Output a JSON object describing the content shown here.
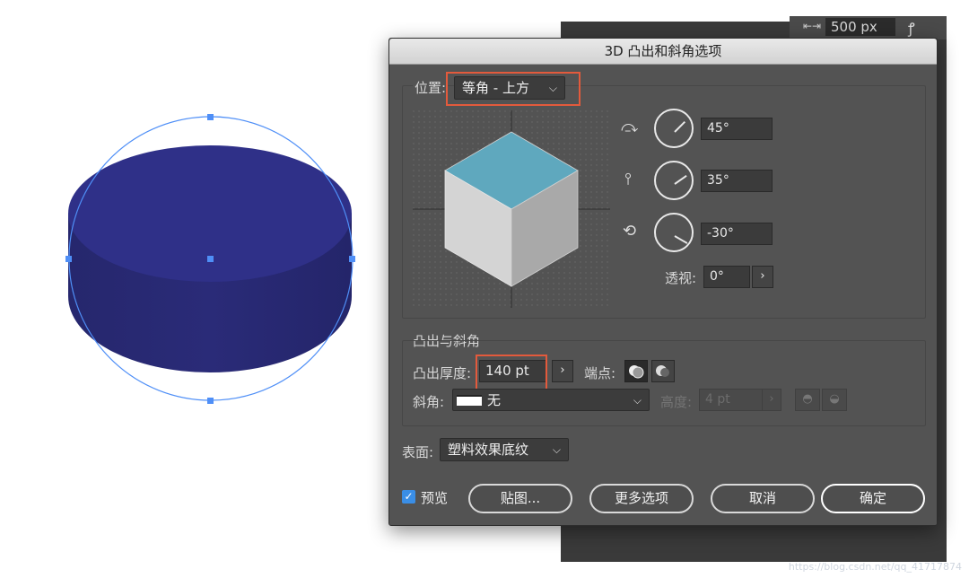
{
  "background_panel": {
    "size_value": "500 px"
  },
  "dialog": {
    "title": "3D 凸出和斜角选项",
    "position": {
      "label": "位置:",
      "selected": "等角 - 上方",
      "rotation_x": "45°",
      "rotation_y": "35°",
      "rotation_z": "-30°",
      "perspective_label": "透视:",
      "perspective_value": "0°"
    },
    "extrude": {
      "section_title": "凸出与斜角",
      "depth_label": "凸出厚度:",
      "depth_value": "140 pt",
      "cap_label": "端点:",
      "bevel_label": "斜角:",
      "bevel_value": "无",
      "height_label": "高度:",
      "height_value": "4 pt"
    },
    "surface": {
      "label": "表面:",
      "selected": "塑料效果底纹"
    },
    "footer": {
      "preview_label": "预览",
      "preview_checked": true,
      "map_button": "贴图...",
      "more_options_button": "更多选项",
      "cancel_button": "取消",
      "ok_button": "确定"
    }
  },
  "colors": {
    "cylinder": "#2f3088",
    "selection": "#4f8ff7",
    "cube_top": "#5fa8be",
    "highlight": "#e35a3c"
  },
  "watermark": "https://blog.csdn.net/qq_41717874"
}
